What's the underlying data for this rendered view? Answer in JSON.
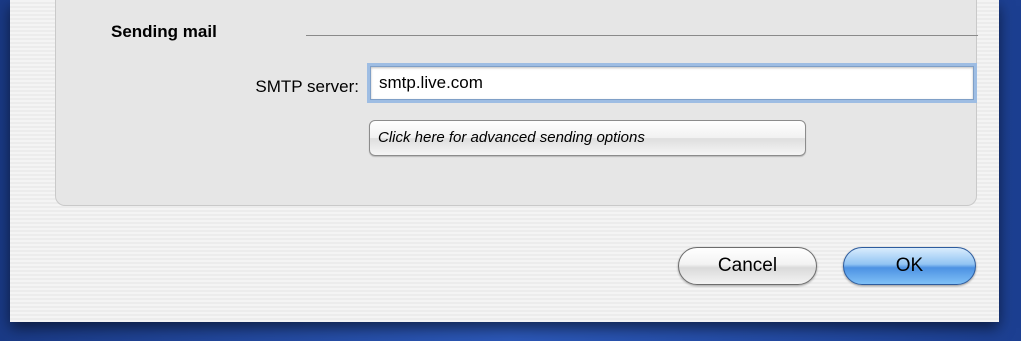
{
  "section": {
    "title": "Sending mail"
  },
  "smtp": {
    "label": "SMTP server:",
    "value": "smtp.live.com"
  },
  "advanced": {
    "label": "Click here for advanced sending options"
  },
  "buttons": {
    "cancel": "Cancel",
    "ok": "OK"
  },
  "colors": {
    "desktop": "#2c58b8",
    "focus_ring": "#9ebde3",
    "default_button": "#4d92e3"
  }
}
